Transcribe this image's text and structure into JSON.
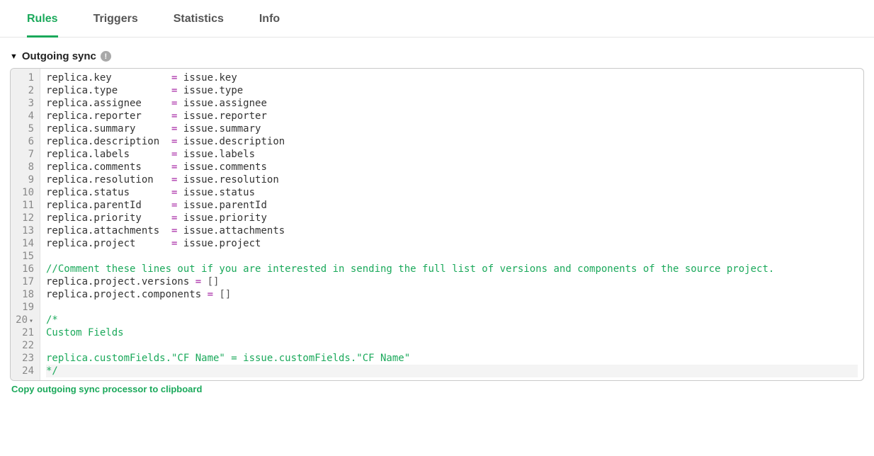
{
  "tabs": {
    "rules": "Rules",
    "triggers": "Triggers",
    "statistics": "Statistics",
    "info": "Info"
  },
  "section": {
    "title": "Outgoing sync"
  },
  "copy_link": "Copy outgoing sync processor to clipboard",
  "code": {
    "lines": [
      {
        "n": 1,
        "type": "assign",
        "lhs": "replica.key",
        "rhs": "issue.key"
      },
      {
        "n": 2,
        "type": "assign",
        "lhs": "replica.type",
        "rhs": "issue.type"
      },
      {
        "n": 3,
        "type": "assign",
        "lhs": "replica.assignee",
        "rhs": "issue.assignee"
      },
      {
        "n": 4,
        "type": "assign",
        "lhs": "replica.reporter",
        "rhs": "issue.reporter"
      },
      {
        "n": 5,
        "type": "assign",
        "lhs": "replica.summary",
        "rhs": "issue.summary"
      },
      {
        "n": 6,
        "type": "assign",
        "lhs": "replica.description",
        "rhs": "issue.description"
      },
      {
        "n": 7,
        "type": "assign",
        "lhs": "replica.labels",
        "rhs": "issue.labels"
      },
      {
        "n": 8,
        "type": "assign",
        "lhs": "replica.comments",
        "rhs": "issue.comments"
      },
      {
        "n": 9,
        "type": "assign",
        "lhs": "replica.resolution",
        "rhs": "issue.resolution"
      },
      {
        "n": 10,
        "type": "assign",
        "lhs": "replica.status",
        "rhs": "issue.status"
      },
      {
        "n": 11,
        "type": "assign",
        "lhs": "replica.parentId",
        "rhs": "issue.parentId"
      },
      {
        "n": 12,
        "type": "assign",
        "lhs": "replica.priority",
        "rhs": "issue.priority"
      },
      {
        "n": 13,
        "type": "assign",
        "lhs": "replica.attachments",
        "rhs": "issue.attachments"
      },
      {
        "n": 14,
        "type": "assign",
        "lhs": "replica.project",
        "rhs": "issue.project"
      },
      {
        "n": 15,
        "type": "blank"
      },
      {
        "n": 16,
        "type": "line_comment",
        "text": "//Comment these lines out if you are interested in sending the full list of versions and components of the source project."
      },
      {
        "n": 17,
        "type": "assign_arr",
        "lhs": "replica.project.versions"
      },
      {
        "n": 18,
        "type": "assign_arr",
        "lhs": "replica.project.components"
      },
      {
        "n": 19,
        "type": "blank"
      },
      {
        "n": 20,
        "type": "block_open",
        "text": "/*",
        "fold": true
      },
      {
        "n": 21,
        "type": "block_body",
        "text": "Custom Fields"
      },
      {
        "n": 22,
        "type": "blank"
      },
      {
        "n": 23,
        "type": "block_body",
        "text": "replica.customFields.\"CF Name\" = issue.customFields.\"CF Name\""
      },
      {
        "n": 24,
        "type": "block_close",
        "text": "*/",
        "hl": true
      }
    ],
    "align_col": 20
  }
}
